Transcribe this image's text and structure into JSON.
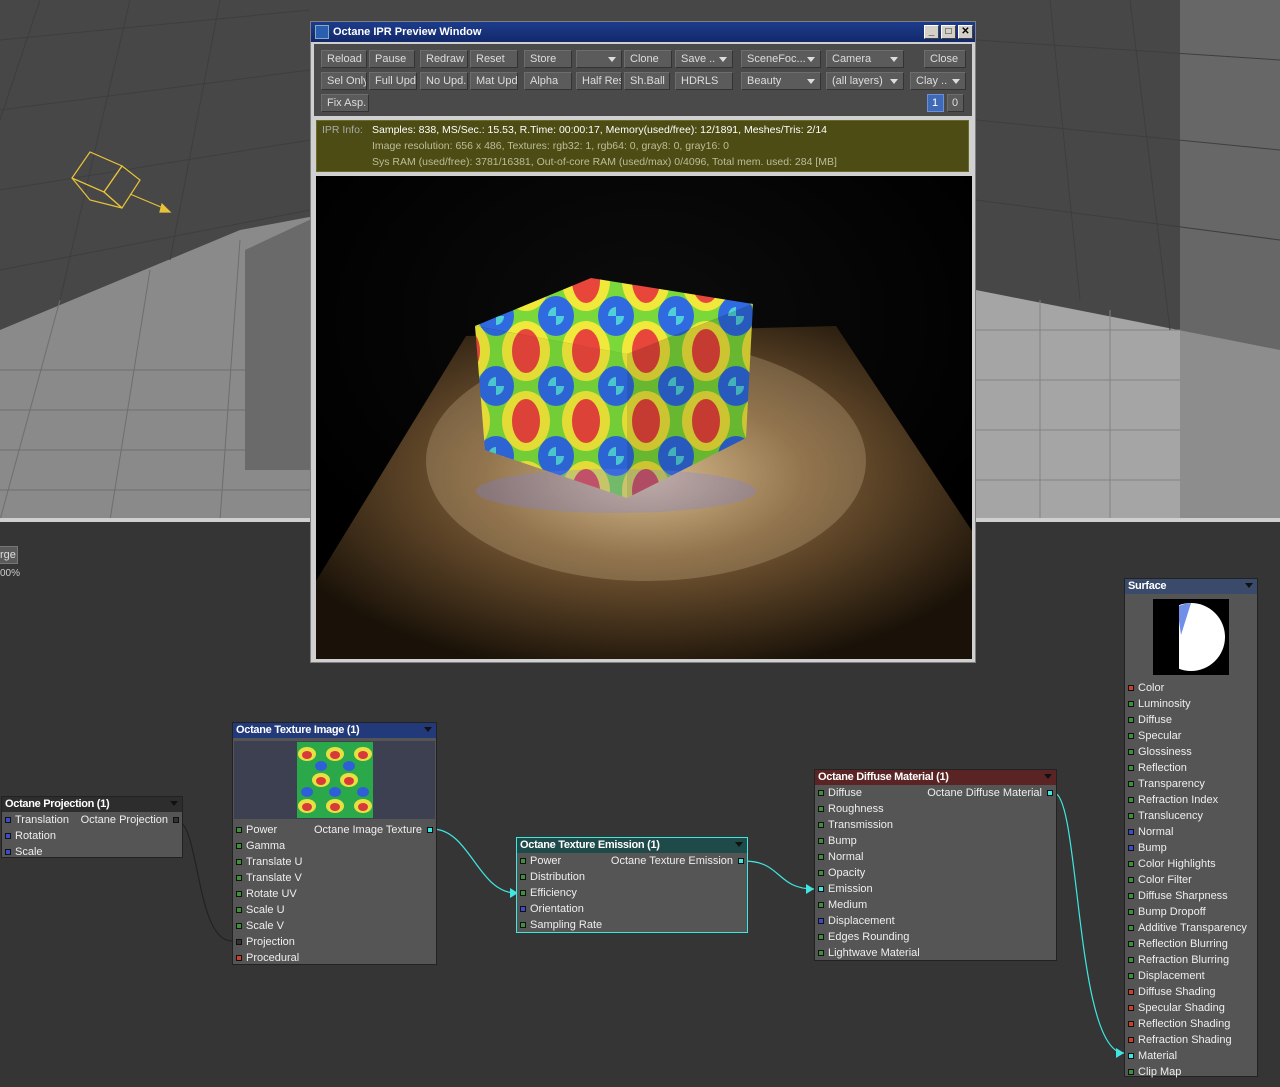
{
  "ipr": {
    "title": "Octane IPR Preview Window",
    "min": "_",
    "max": "□",
    "close": "✕",
    "buttons": {
      "reload": "Reload",
      "pause": "Pause",
      "redraw": "Redraw",
      "reset": "Reset",
      "store": "Store",
      "clone": "Clone",
      "save": "Save ..",
      "scenefoc": "SceneFoc...",
      "camera": "Camera",
      "close": "Close",
      "sel_only": "Sel Only",
      "full_upd": "Full Upd.",
      "no_upd": "No Upd.",
      "mat_upd": "Mat Upd",
      "alpha": "Alpha",
      "half_res": "Half Res",
      "sh_ball": "Sh.Ball",
      "hdrls": "HDRLS",
      "beauty": "Beauty",
      "all_layers": "(all layers)",
      "clay": "Clay ..",
      "fix_asp": "Fix Asp.",
      "page1": "1",
      "page0": "0"
    },
    "info_label": "IPR Info:",
    "info_line1": "Samples: 838, MS/Sec.: 15.53, R.Time: 00:00:17, Memory(used/free): 12/1891, Meshes/Tris: 2/14",
    "info_line2": "Image resolution: 656 x 486, Textures: rgb32: 1, rgb64: 0, gray8: 0, gray16: 0",
    "info_line3": "Sys RAM (used/free): 3781/16381, Out-of-core RAM (used/max) 0/4096, Total mem. used: 284 [MB]"
  },
  "stub": {
    "button": "rge",
    "percent": "00%"
  },
  "nodes": {
    "projection": {
      "title": "Octane Projection (1)",
      "inputs": [
        "Translation",
        "Rotation",
        "Scale"
      ],
      "output": "Octane Projection"
    },
    "texture_image": {
      "title": "Octane Texture Image (1)",
      "inputs": [
        "Power",
        "Gamma",
        "Translate U",
        "Translate V",
        "Rotate UV",
        "Scale U",
        "Scale V",
        "Projection",
        "Procedural"
      ],
      "output": "Octane Image Texture"
    },
    "texture_emission": {
      "title": "Octane Texture Emission (1)",
      "inputs": [
        "Power",
        "Distribution",
        "Efficiency",
        "Orientation",
        "Sampling Rate"
      ],
      "output": "Octane Texture Emission"
    },
    "diffuse_material": {
      "title": "Octane Diffuse Material (1)",
      "inputs": [
        "Diffuse",
        "Roughness",
        "Transmission",
        "Bump",
        "Normal",
        "Opacity",
        "Emission",
        "Medium",
        "Displacement",
        "Edges Rounding",
        "Lightwave Material"
      ],
      "output": "Octane Diffuse Material"
    },
    "surface": {
      "title": "Surface",
      "inputs": [
        "Color",
        "Luminosity",
        "Diffuse",
        "Specular",
        "Glossiness",
        "Reflection",
        "Transparency",
        "Refraction Index",
        "Translucency",
        "Normal",
        "Bump",
        "Color Highlights",
        "Color Filter",
        "Diffuse Sharpness",
        "Bump Dropoff",
        "Additive Transparency",
        "Reflection Blurring",
        "Refraction Blurring",
        "Displacement",
        "Diffuse Shading",
        "Specular Shading",
        "Reflection Shading",
        "Refraction Shading",
        "Material",
        "Clip Map"
      ]
    }
  },
  "colors": {
    "wire": "#3ee8e0",
    "info_bg": "#4c4c14",
    "title_projection": "#2d2d2d",
    "title_texture": "#223a7a",
    "title_emission": "#1e4a4a",
    "title_material": "#5a2424",
    "title_surface": "#3a4a6a"
  }
}
